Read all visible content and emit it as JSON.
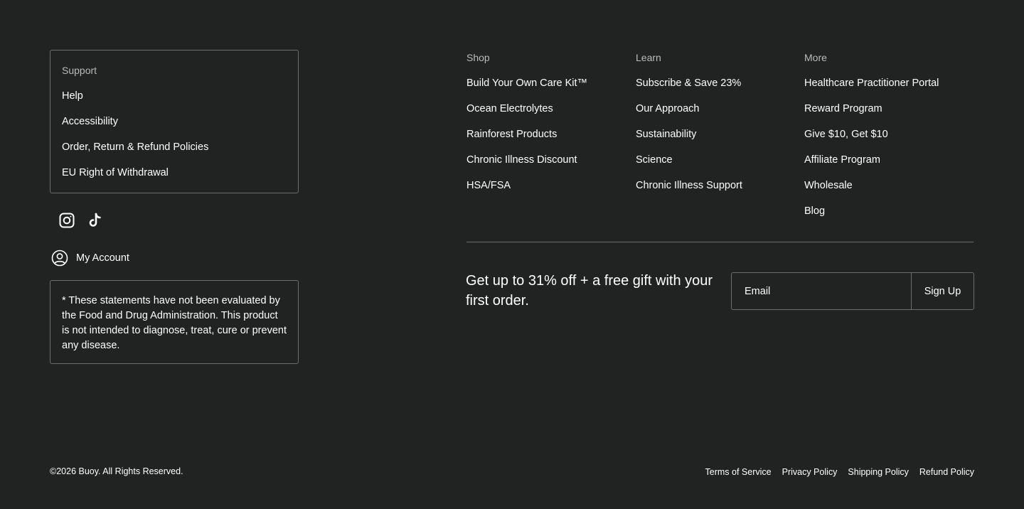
{
  "support": {
    "heading": "Support",
    "links": [
      "Help",
      "Accessibility",
      "Order, Return & Refund Policies",
      "EU Right of Withdrawal"
    ]
  },
  "social": {
    "icons": [
      "instagram-icon",
      "tiktok-icon"
    ]
  },
  "account": {
    "icon": "user-circle-icon",
    "label": "My Account"
  },
  "disclaimer": "* These statements have not been evaluated by the Food and Drug Administration. This product is not intended to diagnose, treat, cure or prevent any disease.",
  "shop": {
    "heading": "Shop",
    "links": [
      "Build Your Own Care Kit™",
      "Ocean Electrolytes",
      "Rainforest Products",
      "Chronic Illness Discount",
      "HSA/FSA"
    ]
  },
  "learn": {
    "heading": "Learn",
    "links": [
      "Subscribe & Save 23%",
      "Our Approach",
      "Sustainability",
      "Science",
      "Chronic Illness Support"
    ]
  },
  "more": {
    "heading": "More",
    "links": [
      "Healthcare Practitioner Portal",
      "Reward Program",
      "Give $10, Get $10",
      "Affiliate Program",
      "Wholesale",
      "Blog"
    ]
  },
  "newsletter": {
    "text": "Get up to 31% off + a free gift with your first order.",
    "placeholder": "Email",
    "button": "Sign Up"
  },
  "copyright": "©2026 Buoy. All Rights Reserved.",
  "legal": [
    "Terms of Service",
    "Privacy Policy",
    "Shipping Policy",
    "Refund Policy"
  ],
  "colors": {
    "background": "#202322",
    "border": "#6a6e6c",
    "heading": "#b9bcbb",
    "text": "#ffffff"
  }
}
